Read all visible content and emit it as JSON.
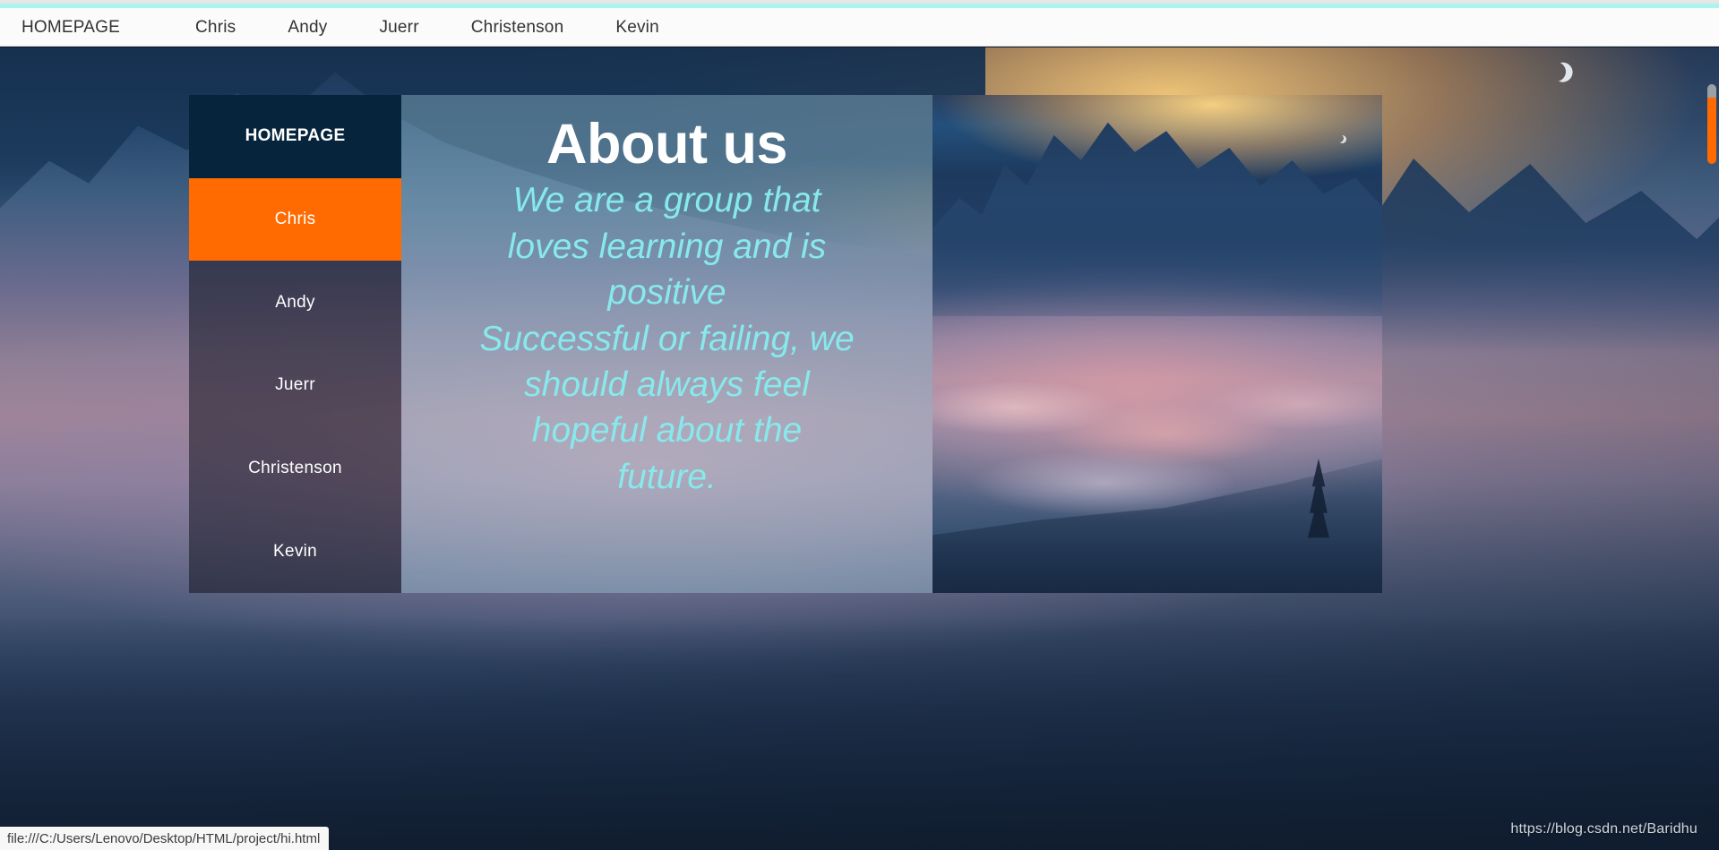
{
  "browser": {
    "status_url": "file:///C:/Users/Lenovo/Desktop/HTML/project/hi.html",
    "accent_color": "#aaf5f0",
    "scrollbar_thumb_color": "#ff6b00"
  },
  "topnav": {
    "items": [
      {
        "label": "HOMEPAGE"
      },
      {
        "label": "Chris"
      },
      {
        "label": "Andy"
      },
      {
        "label": "Juerr"
      },
      {
        "label": "Christenson"
      },
      {
        "label": "Kevin"
      }
    ]
  },
  "sidemenu": {
    "active_color": "#ff6b00",
    "head_color": "#06253c",
    "items": [
      {
        "label": "HOMEPAGE",
        "state": "head"
      },
      {
        "label": "Chris",
        "state": "active"
      },
      {
        "label": "Andy",
        "state": "normal"
      },
      {
        "label": "Juerr",
        "state": "normal"
      },
      {
        "label": "Christenson",
        "state": "normal"
      },
      {
        "label": "Kevin",
        "state": "normal"
      }
    ]
  },
  "about": {
    "title": "About us",
    "text_color": "#87e9ec",
    "lines": [
      "We are a group that",
      "loves learning and is",
      "positive",
      "Successful or failing, we",
      "should always feel",
      "hopeful about the",
      "future."
    ]
  },
  "photo": {
    "alt": "snow-capped mountains above a sea of pink sunset clouds"
  },
  "hero": {
    "alt": "alpine dusk landscape with crescent moon"
  },
  "icons": {
    "moon": "crescent-moon-icon"
  },
  "watermark": {
    "text": "https://blog.csdn.net/Baridhu"
  }
}
